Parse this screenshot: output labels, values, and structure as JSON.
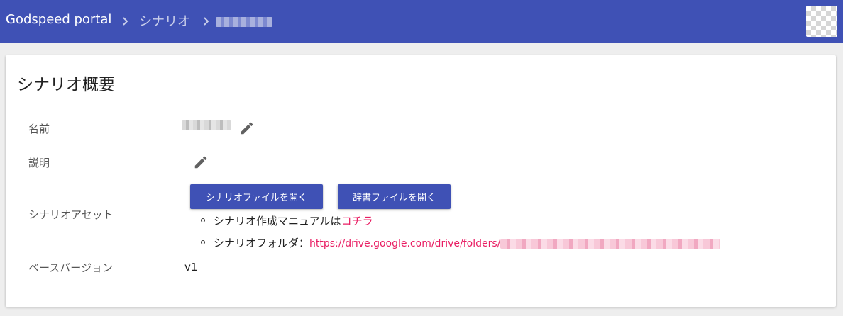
{
  "header": {
    "brand": "Godspeed portal",
    "breadcrumbs": [
      "シナリオ"
    ],
    "separator_icon": "chevron-right-icon"
  },
  "card": {
    "title": "シナリオ概要",
    "fields": {
      "name_label": "名前",
      "description_label": "説明",
      "assets_label": "シナリオアセット",
      "base_version_label": "ベースバージョン",
      "base_version_value": "v1"
    },
    "buttons": {
      "open_scenario_file": "シナリオファイルを開く",
      "open_dictionary_file": "辞書ファイルを開く"
    },
    "bullets": {
      "manual_text": "シナリオ作成マニュアルは",
      "manual_link": "コチラ",
      "folder_text": "シナリオフォルダ：",
      "folder_link": "https://drive.google.com/drive/folders/"
    }
  },
  "colors": {
    "primary": "#3f51b5",
    "link": "#e91e63",
    "background": "#eeeeee"
  }
}
